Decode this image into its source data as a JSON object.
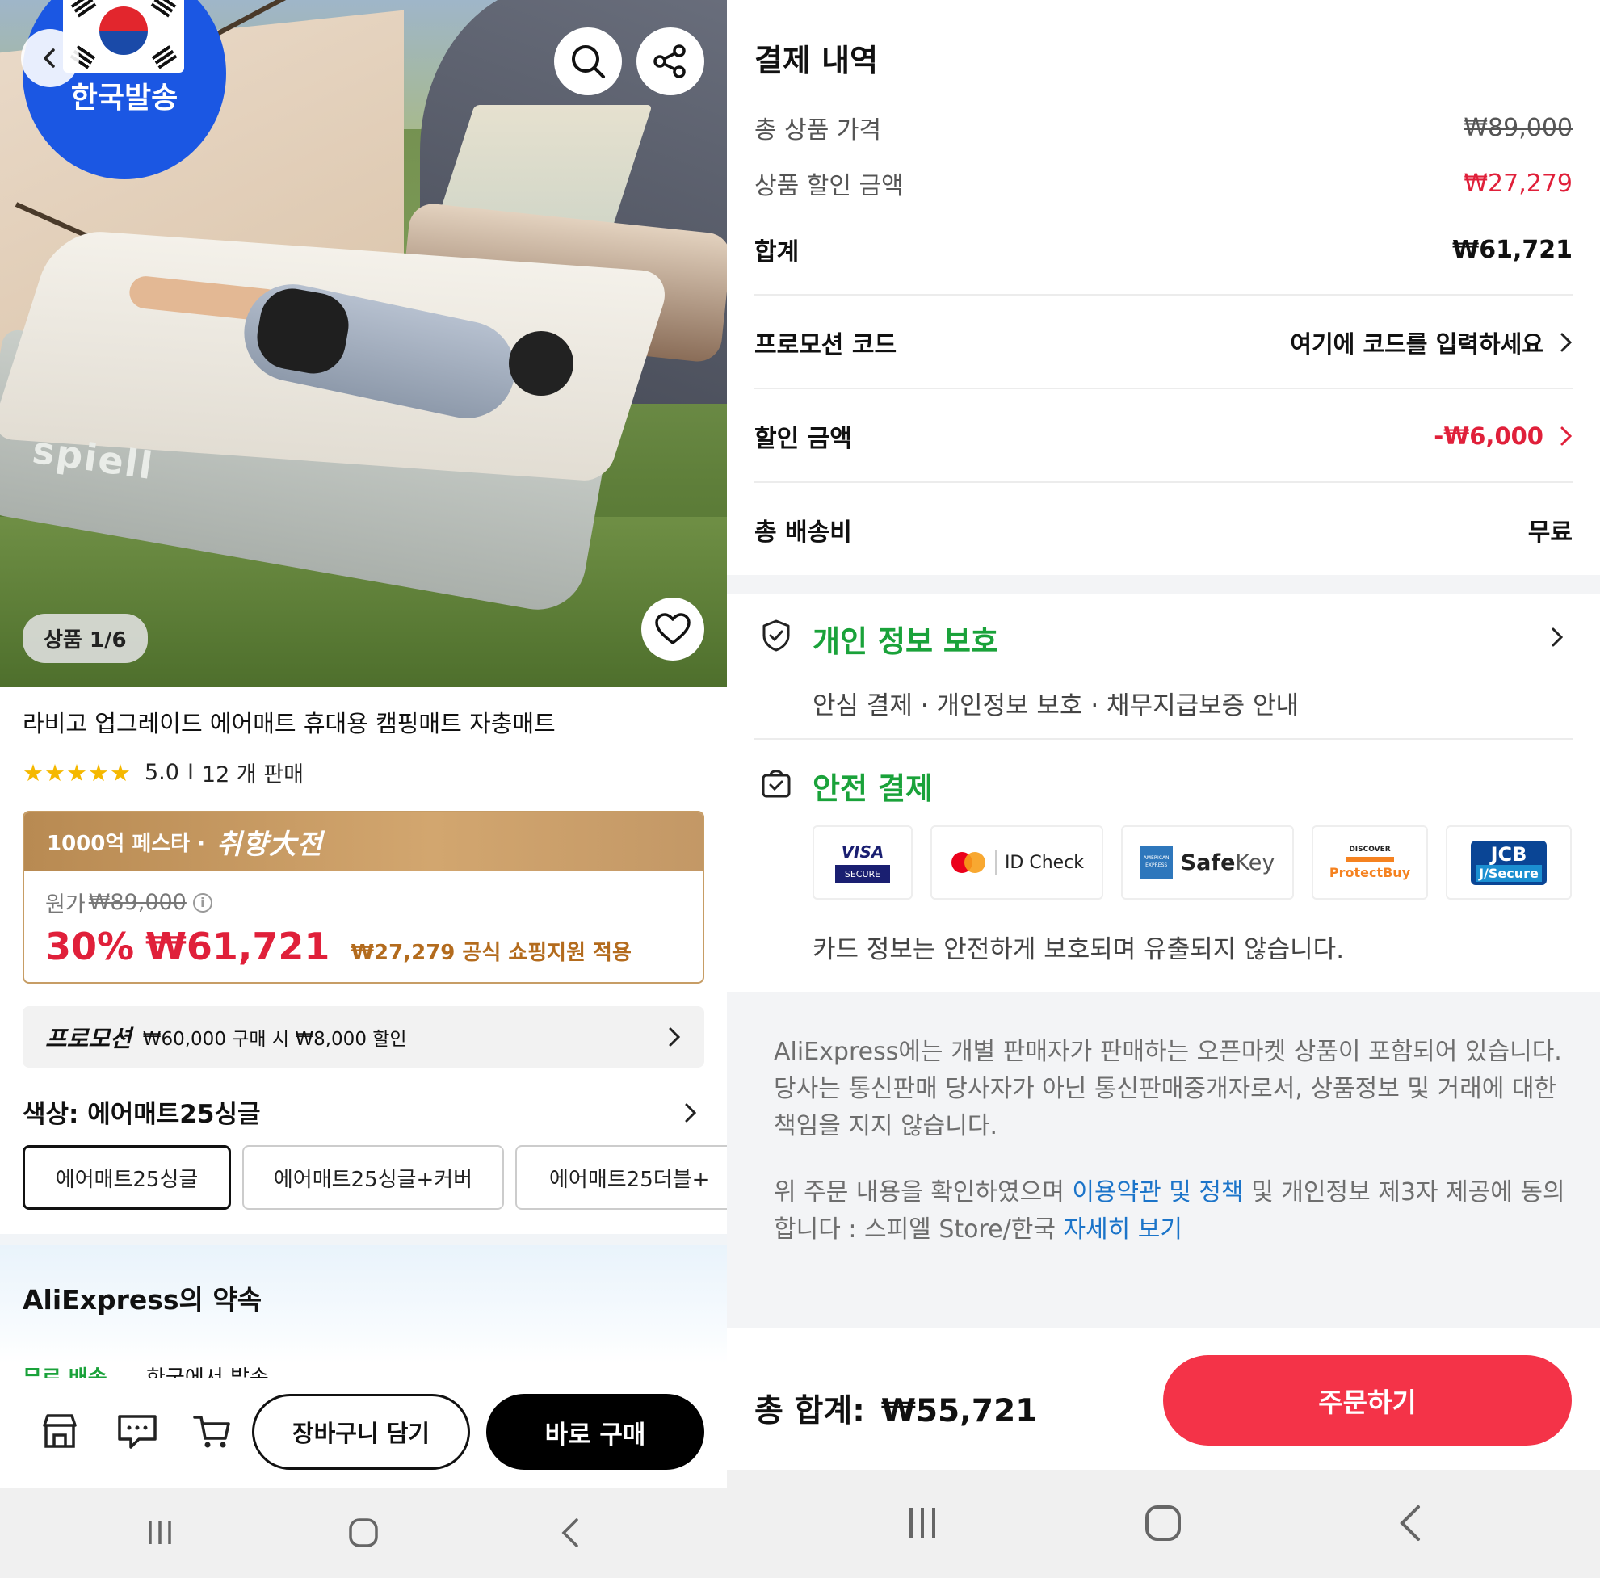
{
  "left": {
    "hero": {
      "brand_text": "spiell",
      "ship_badge": "한국발송",
      "image_counter": "상품 1/6"
    },
    "product": {
      "title": "라비고 업그레이드 에어매트 휴대용 캠핑매트 자충매트",
      "stars": "★★★★★",
      "rating": "5.0",
      "separator": "I",
      "sold": "12 개 판매"
    },
    "deal": {
      "banner_prefix": "1000억 페스타 ·",
      "banner_fest": "취향大전",
      "original_label": "원가",
      "original_price": "₩89,000",
      "info": "i",
      "discount": "30%",
      "price": "₩61,721",
      "subsidy": "₩27,279 공식 쇼핑지원 적용"
    },
    "promotion": {
      "tag": "프로모션",
      "desc": "₩60,000 구매 시 ₩8,000 할인"
    },
    "color": {
      "title": "색상: 에어매트25싱글",
      "options": [
        "에어매트25싱글",
        "에어매트25싱글+커버",
        "에어매트25더블+"
      ],
      "selected_index": 0
    },
    "promise": {
      "title": "AliExpress의 약속",
      "peek_green": "무료 배송",
      "peek_text": "한국에서 발송"
    },
    "bottom": {
      "cart_label": "장바구니 담기",
      "buy_label": "바로 구매"
    }
  },
  "right": {
    "title": "결제 내역",
    "rows": {
      "subtotal_label": "총 상품 가격",
      "subtotal_value": "₩89,000",
      "discount_label": "상품 할인 금액",
      "discount_value": "₩27,279",
      "sum_label": "합계",
      "sum_value": "₩61,721",
      "promo_label": "프로모션 코드",
      "promo_value": "여기에 코드를 입력하세요",
      "coupon_label": "할인 금액",
      "coupon_value": "-₩6,000",
      "shipping_label": "총 배송비",
      "shipping_value": "무료"
    },
    "privacy": {
      "title": "개인 정보 보호",
      "sub": "안심 결제 · 개인정보 보호 · 채무지급보증 안내"
    },
    "secure": {
      "title": "안전 결제",
      "cards": {
        "visa_top": "VISA",
        "visa_bottom": "SECURE",
        "mc": "ID Check",
        "amex_badge": "AMERICAN EXPRESS",
        "safekey_bold": "Safe",
        "safekey_light": "Key",
        "discover": "DISCOVER",
        "protectbuy": "ProtectBuy",
        "jcb_top": "JCB",
        "jcb_bottom": "J/Secure"
      },
      "note": "카드 정보는 안전하게 보호되며 유출되지 않습니다."
    },
    "notice": {
      "p1": "AliExpress에는 개별 판매자가 판매하는 오픈마켓 상품이 포함되어 있습니다. 당사는 통신판매 당사자가 아닌 통신판매중개자로서, 상품정보 및 거래에 대한 책임을 지지 않습니다.",
      "p2_a": "위 주문 내용을 확인하였으며 ",
      "p2_link1": "이용약관 및 정책",
      "p2_b": " 및 개인정보 제3자 제공에 동의합니다 : 스피엘 Store/한국 ",
      "p2_link2": "자세히 보기"
    },
    "bottom": {
      "total_label": "총 합계:",
      "total_value": "₩55,721",
      "order_label": "주문하기"
    }
  },
  "colors": {
    "accent_red": "#e0203a",
    "order_button": "#f43348",
    "green": "#1aa23a",
    "link_blue": "#1b74c9",
    "deal_gold": "#c79d65",
    "ship_badge_blue": "#1b57e3",
    "star": "#f5b800"
  },
  "icons": [
    "back-icon",
    "search-icon",
    "share-icon",
    "heart-icon",
    "store-icon",
    "chat-icon",
    "cart-icon",
    "shield-icon",
    "secure-bag-icon",
    "chevron-right-icon",
    "nav-recents-icon",
    "nav-home-icon",
    "nav-back-icon"
  ]
}
